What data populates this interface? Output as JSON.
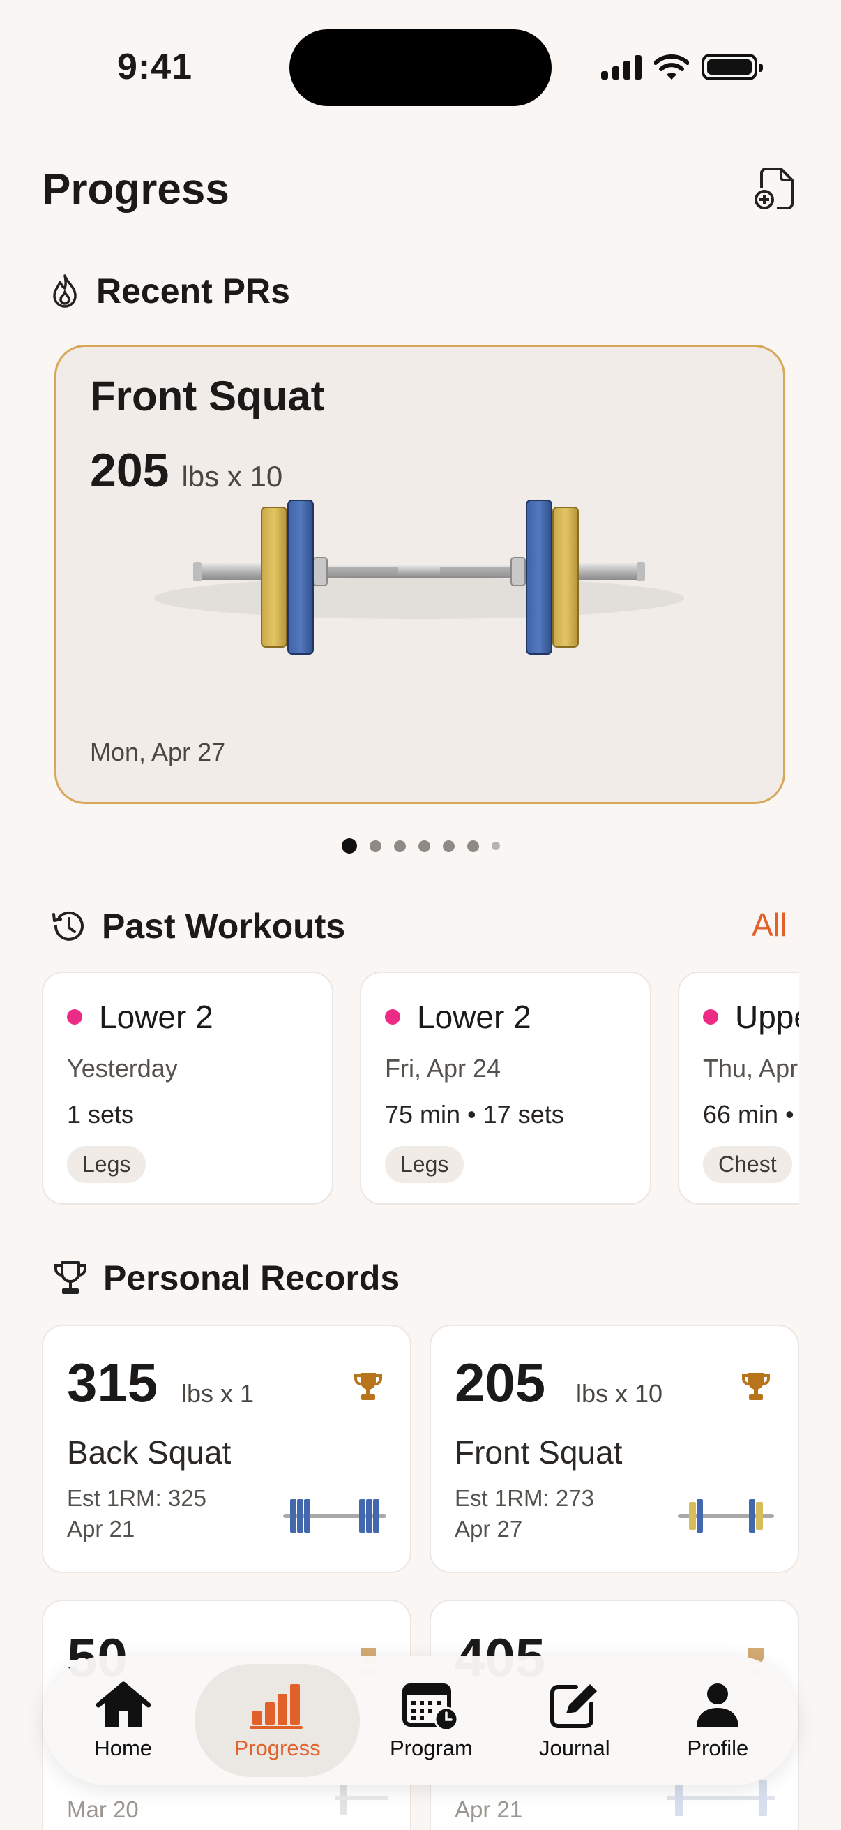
{
  "status": {
    "time": "9:41"
  },
  "header": {
    "title": "Progress"
  },
  "recent_prs": {
    "heading": "Recent PRs",
    "card": {
      "exercise": "Front Squat",
      "weight": "205",
      "detail": "lbs x 10",
      "date": "Mon, Apr 27"
    },
    "page_count": 7,
    "active_page": 1
  },
  "past_workouts": {
    "heading": "Past Workouts",
    "all_label": "All",
    "items": [
      {
        "title": "Lower 2",
        "date": "Yesterday",
        "stats": "1 sets",
        "tag": "Legs"
      },
      {
        "title": "Lower 2",
        "date": "Fri, Apr 24",
        "stats": "75 min • 17 sets",
        "tag": "Legs"
      },
      {
        "title": "Upper",
        "date": "Thu, Apr",
        "stats": "66 min •",
        "tag": "Chest"
      }
    ]
  },
  "personal_records": {
    "heading": "Personal Records",
    "items": [
      {
        "weight": "315",
        "detail": "lbs x 1",
        "exercise": "Back Squat",
        "est_1rm": "Est 1RM: 325",
        "date": "Apr 21"
      },
      {
        "weight": "205",
        "detail": "lbs x 10",
        "exercise": "Front Squat",
        "est_1rm": "Est 1RM: 273",
        "date": "Apr 27"
      },
      {
        "weight": "50",
        "detail": "",
        "exercise": "",
        "est_1rm": "",
        "date": "Mar 20"
      },
      {
        "weight": "405",
        "detail": "",
        "exercise": "",
        "est_1rm": "",
        "date": "Apr 21"
      }
    ]
  },
  "tabbar": {
    "items": [
      {
        "label": "Home",
        "icon": "house-icon"
      },
      {
        "label": "Progress",
        "icon": "bar-chart-icon"
      },
      {
        "label": "Program",
        "icon": "calendar-clock-icon"
      },
      {
        "label": "Journal",
        "icon": "pencil-square-icon"
      },
      {
        "label": "Profile",
        "icon": "person-icon"
      }
    ],
    "active": "Progress"
  },
  "colors": {
    "accent": "#e2612a",
    "workout_dot": "#ec2b86",
    "pr_border": "#d9a75a",
    "trophy": "#b8741a"
  }
}
